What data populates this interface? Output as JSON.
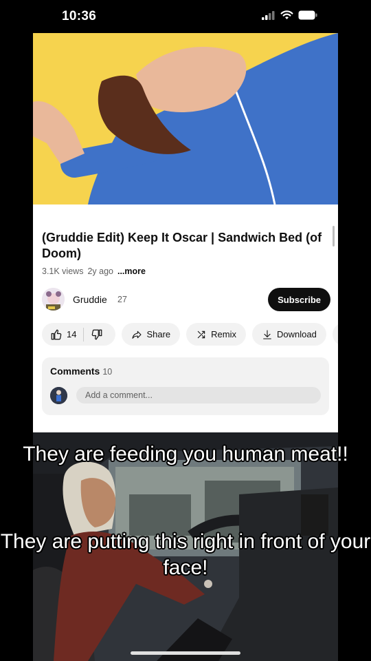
{
  "status_bar": {
    "time": "10:36",
    "icons": [
      "signal-icon",
      "wifi-icon",
      "battery-icon"
    ]
  },
  "video": {
    "title": "(Gruddie Edit) Keep It Oscar | Sandwich Bed (of Doom)",
    "views": "3.1K views",
    "age": "2y ago",
    "more_label": "...more"
  },
  "channel": {
    "name": "Gruddie",
    "subscriber_count": "27",
    "subscribe_label": "Subscribe"
  },
  "actions": {
    "like_count": "14",
    "share_label": "Share",
    "remix_label": "Remix",
    "download_label": "Download"
  },
  "comments": {
    "title": "Comments",
    "count": "10",
    "placeholder": "Add a comment..."
  },
  "overlay": {
    "caption_top": "They are feeding you human meat!!",
    "caption_bottom": "They are putting this right in front of your face!"
  },
  "colors": {
    "subscribe_bg": "#0f0f0f",
    "thumb_bg": "#f6d34e",
    "pill_bg": "#f2f2f2"
  }
}
